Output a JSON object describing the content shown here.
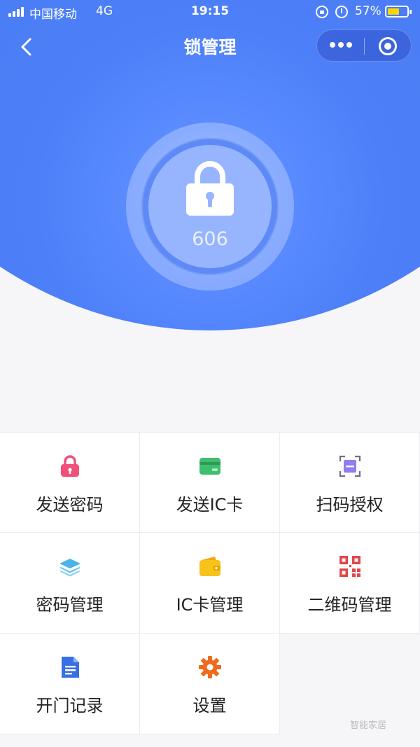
{
  "status_bar": {
    "carrier": "中国移动",
    "network": "4G",
    "time": "19:15",
    "battery": "57%",
    "icons": [
      "signal-icon",
      "orientation-lock-icon",
      "alarm-icon",
      "battery-icon"
    ]
  },
  "nav": {
    "title": "锁管理",
    "back_icon": "chevron-left-icon",
    "menu_icon": "more-icon",
    "close_icon": "close-miniprogram-icon"
  },
  "lock": {
    "icon": "padlock-icon",
    "number": "606"
  },
  "menu": [
    {
      "label": "发送密码",
      "icon": "pink-lock-icon"
    },
    {
      "label": "发送IC卡",
      "icon": "green-card-icon"
    },
    {
      "label": "扫码授权",
      "icon": "scan-icon"
    },
    {
      "label": "密码管理",
      "icon": "layers-icon"
    },
    {
      "label": "IC卡管理",
      "icon": "wallet-icon"
    },
    {
      "label": "二维码管理",
      "icon": "qr-code-icon"
    },
    {
      "label": "开门记录",
      "icon": "document-icon"
    },
    {
      "label": "设置",
      "icon": "gear-icon"
    }
  ],
  "watermark": "智能家居",
  "colors": {
    "primary": "#4a7cf4",
    "pink": "#f0507a",
    "green": "#3fbf6e",
    "purple": "#8f7ef2",
    "teal": "#4ab4e6",
    "yellow": "#f7c21a",
    "red": "#e0474a",
    "blue": "#3a6fe3",
    "orange": "#f06a1c"
  }
}
